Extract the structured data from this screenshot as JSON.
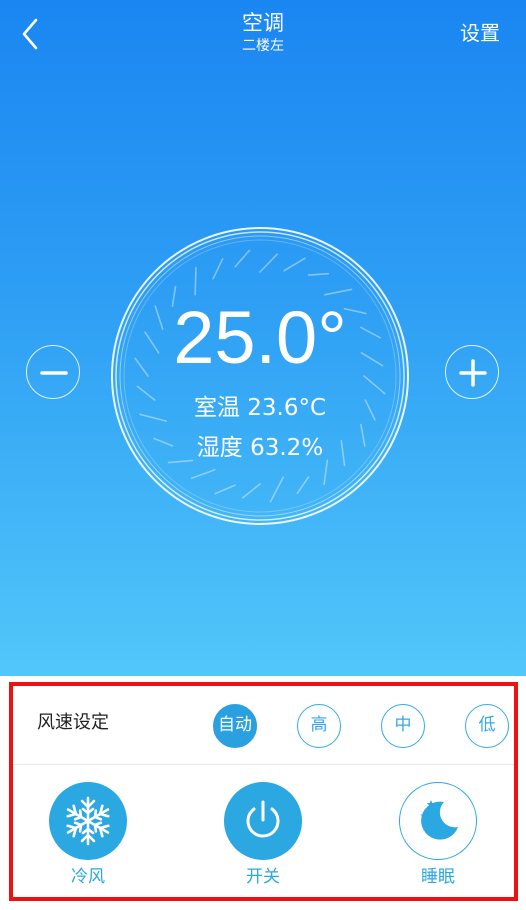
{
  "header": {
    "title": "空调",
    "subtitle": "二楼左",
    "settings_label": "设置"
  },
  "thermostat": {
    "setpoint": "25.0°",
    "room_temp_label": "室温",
    "room_temp_value": "23.6°C",
    "humidity_label": "湿度",
    "humidity_value": "63.2%"
  },
  "fan_speed": {
    "label": "风速设定",
    "options": [
      {
        "label": "自动",
        "selected": true
      },
      {
        "label": "高",
        "selected": false
      },
      {
        "label": "中",
        "selected": false
      },
      {
        "label": "低",
        "selected": false
      }
    ]
  },
  "actions": [
    {
      "label": "冷风",
      "icon": "snowflake-icon"
    },
    {
      "label": "开关",
      "icon": "power-icon"
    },
    {
      "label": "睡眠",
      "icon": "moon-stars-icon"
    }
  ],
  "colors": {
    "gradient_top": "#1a86f2",
    "gradient_bottom": "#51c7fa",
    "accent": "#2ba7e2",
    "highlight_border": "#ee1111"
  }
}
